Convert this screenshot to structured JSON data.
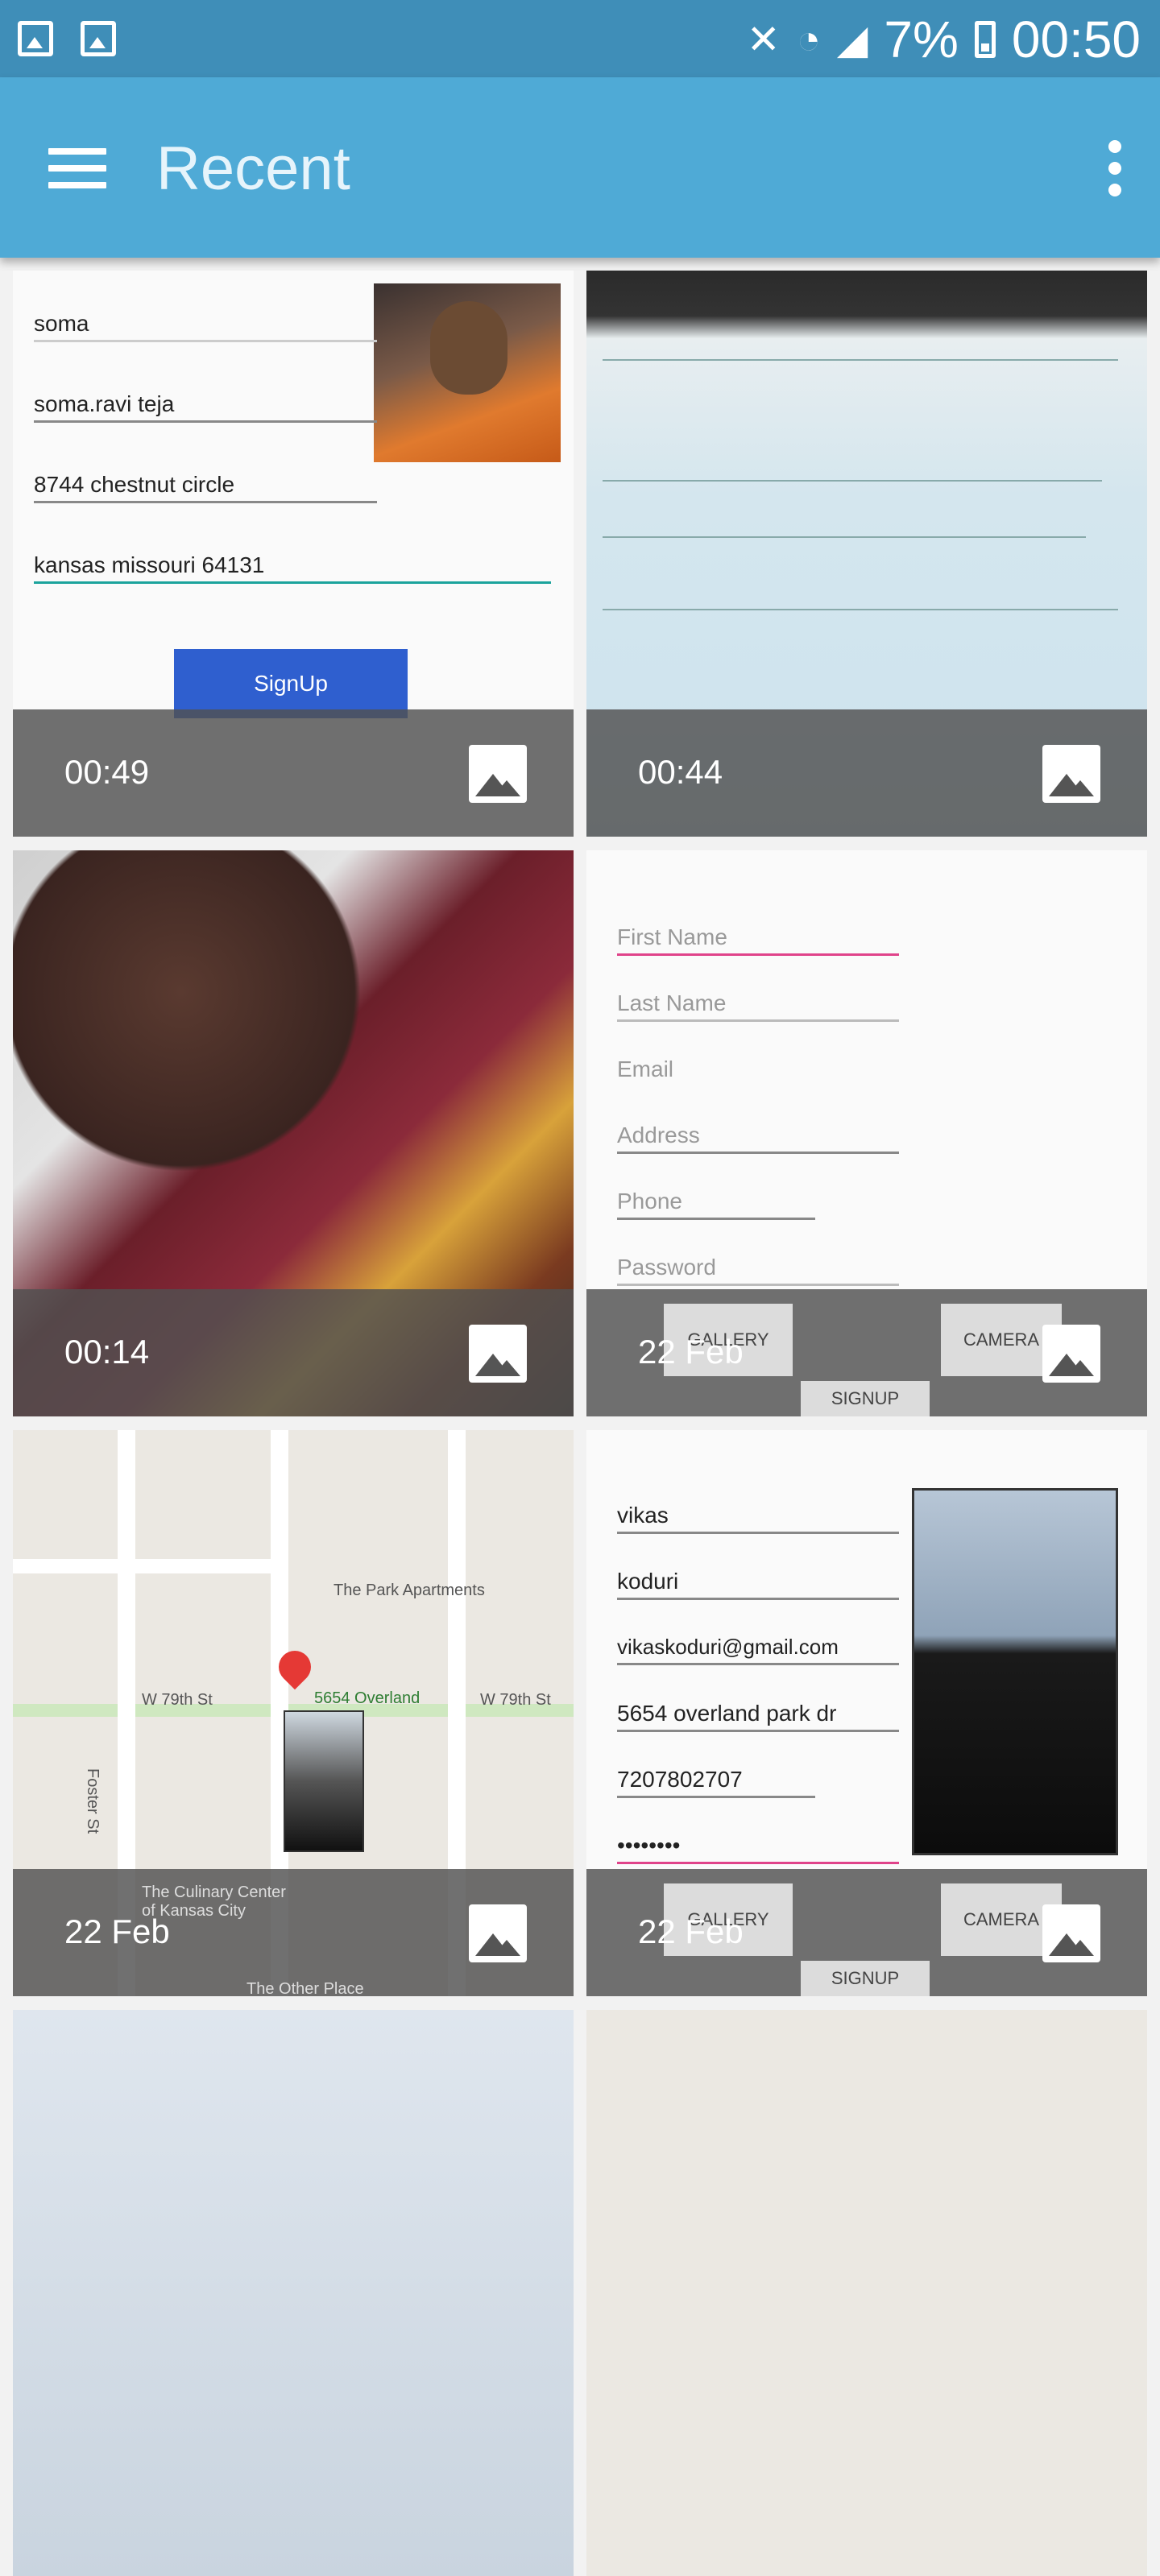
{
  "status_bar": {
    "battery": "7%",
    "time": "00:50",
    "left_icons": [
      "gallery-icon",
      "screenshot-icon"
    ],
    "right_icons": [
      "mute-vibrate-icon",
      "wifi-icon",
      "signal-icon",
      "battery-icon"
    ]
  },
  "app_bar": {
    "title": "Recent",
    "menu_icon": "hamburger-menu-icon",
    "overflow_icon": "more-vert-icon"
  },
  "tiles": [
    {
      "caption": "00:49",
      "type": "image",
      "content": {
        "fields": [
          "soma",
          "soma.ravi teja",
          "8744 chestnut circle",
          "kansas missouri 64131"
        ],
        "button": "SignUp"
      }
    },
    {
      "caption": "00:44",
      "type": "image"
    },
    {
      "caption": "00:14",
      "type": "image"
    },
    {
      "caption": "22 Feb",
      "type": "image",
      "content": {
        "fields": [
          "First Name",
          "Last Name",
          "Email",
          "Address",
          "Phone",
          "Password"
        ],
        "buttons": [
          "GALLERY",
          "CAMERA",
          "SIGNUP"
        ]
      }
    },
    {
      "caption": "22 Feb",
      "type": "image",
      "content": {
        "labels": [
          "The Park Apartments",
          "5654 Overland",
          "W 79th St",
          "W 79th St",
          "Foster St",
          "The Culinary Center of Kansas City",
          "The Other Place"
        ]
      }
    },
    {
      "caption": "22 Feb",
      "type": "image",
      "content": {
        "fields": [
          "vikas",
          "koduri",
          "vikaskoduri@gmail.com",
          "5654 overland park dr",
          "7207802707",
          "••••••••"
        ],
        "buttons": [
          "GALLERY",
          "CAMERA",
          "SIGNUP"
        ]
      }
    }
  ]
}
